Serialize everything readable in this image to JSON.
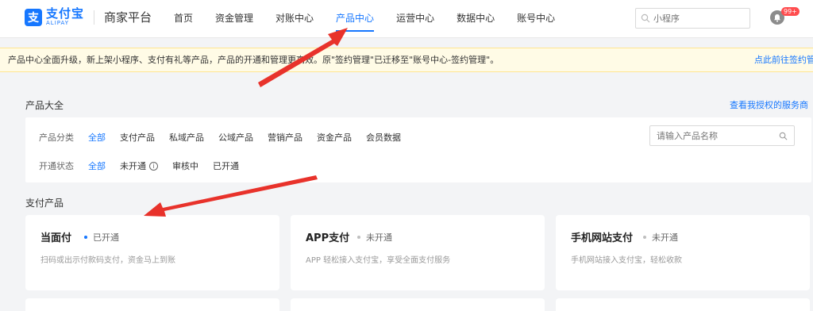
{
  "brand": {
    "logo_glyph": "支",
    "logo_cn": "支付宝",
    "logo_en": "ALIPAY",
    "platform": "商家平台",
    "color": "#1677ff"
  },
  "nav": {
    "items": [
      {
        "label": "首页"
      },
      {
        "label": "资金管理"
      },
      {
        "label": "对账中心"
      },
      {
        "label": "产品中心"
      },
      {
        "label": "运营中心"
      },
      {
        "label": "数据中心"
      },
      {
        "label": "账号中心"
      }
    ],
    "active": "产品中心",
    "search_placeholder": "小程序",
    "notification_badge": "99+"
  },
  "notice": {
    "text": "产品中心全面升级，新上架小程序、支付有礼等产品，产品的开通和管理更高效。原\"签约管理\"已迁移至\"账号中心-签约管理\"。",
    "link": "点此前往签约管"
  },
  "catalog": {
    "title": "产品大全",
    "auth_link": "查看我授权的服务商",
    "category_label": "产品分类",
    "categories": [
      {
        "label": "全部"
      },
      {
        "label": "支付产品"
      },
      {
        "label": "私域产品"
      },
      {
        "label": "公域产品"
      },
      {
        "label": "营销产品"
      },
      {
        "label": "资金产品"
      },
      {
        "label": "会员数据"
      }
    ],
    "status_label": "开通状态",
    "statuses": [
      {
        "label": "全部"
      },
      {
        "label": "未开通"
      },
      {
        "label": "审核中"
      },
      {
        "label": "已开通"
      }
    ],
    "search_placeholder": "请输入产品名称"
  },
  "payment_section": {
    "title": "支付产品",
    "cards": [
      {
        "name": "当面付",
        "status": "已开通",
        "status_color": "#1677ff",
        "desc": "扫码或出示付款码支付，资金马上到账"
      },
      {
        "name": "APP支付",
        "status": "未开通",
        "status_color": "#bfbfbf",
        "desc": "APP 轻松接入支付宝，享受全面支付服务"
      },
      {
        "name": "手机网站支付",
        "status": "未开通",
        "status_color": "#bfbfbf",
        "desc": "手机网站接入支付宝，轻松收款"
      }
    ]
  },
  "annotation_color": "#e8322b"
}
